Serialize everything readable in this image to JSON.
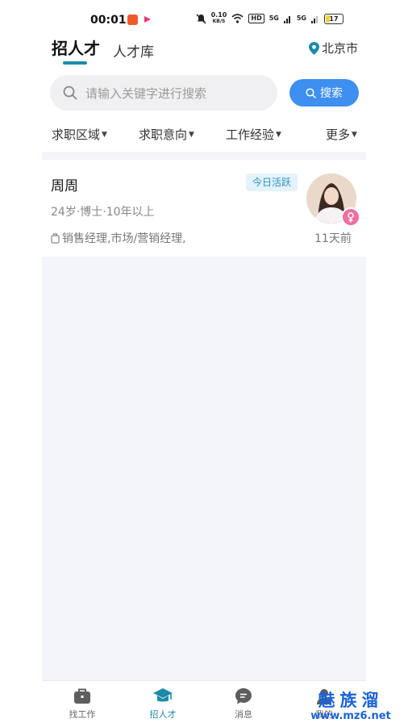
{
  "status_bar": {
    "time": "00:01",
    "net_speed": "0.10",
    "net_unit": "KB/S",
    "hd": "HD",
    "sig1": "5G",
    "sig2": "5G",
    "battery": "17"
  },
  "header": {
    "tab_active": "招人才",
    "tab_inactive": "人才库",
    "city": "北京市"
  },
  "search": {
    "placeholder": "请输入关键字进行搜索",
    "button_label": "搜索"
  },
  "filters": [
    {
      "label": "求职区域"
    },
    {
      "label": "求职意向"
    },
    {
      "label": "工作经验"
    },
    {
      "label": "更多"
    }
  ],
  "candidate": {
    "name": "周周",
    "badge": "今日活跃",
    "meta": "24岁·博士·10年以上",
    "jobs": "销售经理,市场/营销经理,",
    "last_active": "11天前"
  },
  "bottom_nav": [
    {
      "label": "找工作",
      "icon": "briefcase-icon"
    },
    {
      "label": "招人才",
      "icon": "graduation-cap-icon"
    },
    {
      "label": "消息",
      "icon": "message-icon"
    },
    {
      "label": "我的",
      "icon": "user-icon"
    }
  ],
  "watermark": {
    "title": "魅族溜",
    "url": "www.mz6.net"
  },
  "colors": {
    "accent": "#1d8aa8",
    "search_button": "#3d8ff0",
    "badge_bg": "#e3f2fb",
    "badge_text": "#2f8fc4",
    "female": "#f06fa0",
    "watermark": "#1a63d8"
  }
}
